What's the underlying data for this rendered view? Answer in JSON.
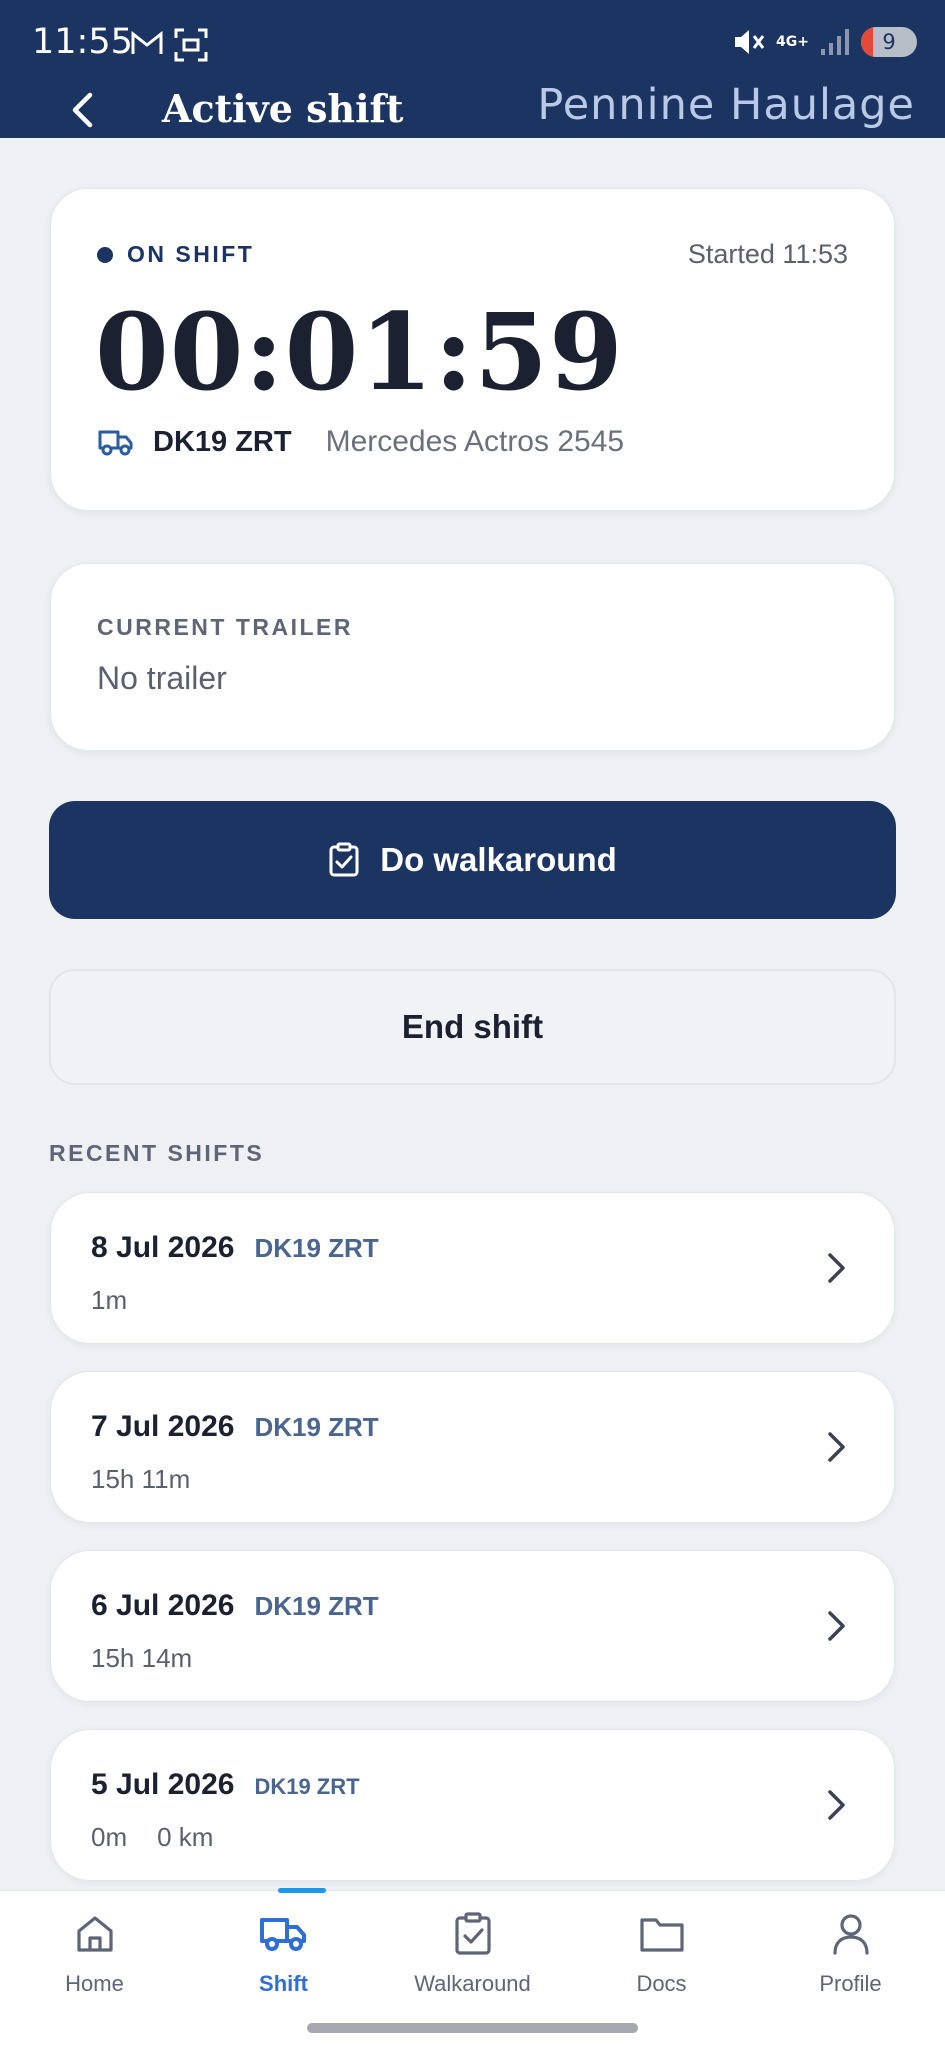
{
  "status_bar": {
    "time": "11:55",
    "network": "4G+",
    "battery": "9"
  },
  "header": {
    "title": "Active shift",
    "brand": "Pennine Haulage"
  },
  "shift": {
    "status": "ON SHIFT",
    "started": "Started 11:53",
    "timer": "00:01:59",
    "registration": "DK19 ZRT",
    "vehicle_model": "Mercedes Actros 2545"
  },
  "trailer": {
    "label": "CURRENT TRAILER",
    "value": "No trailer"
  },
  "actions": {
    "walkaround": "Do walkaround",
    "end_shift": "End shift"
  },
  "recent": {
    "label": "RECENT SHIFTS",
    "rows": [
      {
        "date": "8 Jul 2026",
        "reg": "DK19 ZRT",
        "duration": "1m",
        "distance": ""
      },
      {
        "date": "7 Jul 2026",
        "reg": "DK19 ZRT",
        "duration": "15h 11m",
        "distance": ""
      },
      {
        "date": "6 Jul 2026",
        "reg": "DK19 ZRT",
        "duration": "15h 14m",
        "distance": ""
      },
      {
        "date": "5 Jul 2026",
        "reg": "DK19 ZRT",
        "duration": "0m",
        "distance": "0 km"
      }
    ]
  },
  "nav": {
    "items": [
      {
        "label": "Home",
        "icon": "home-icon"
      },
      {
        "label": "Shift",
        "icon": "truck-icon",
        "active": true
      },
      {
        "label": "Walkaround",
        "icon": "clipboard-check-icon"
      },
      {
        "label": "Docs",
        "icon": "folder-icon"
      },
      {
        "label": "Profile",
        "icon": "person-icon"
      }
    ]
  },
  "colors": {
    "primary": "#1b3462",
    "accent": "#2f6ed6",
    "indicator": "#1f97e8"
  }
}
